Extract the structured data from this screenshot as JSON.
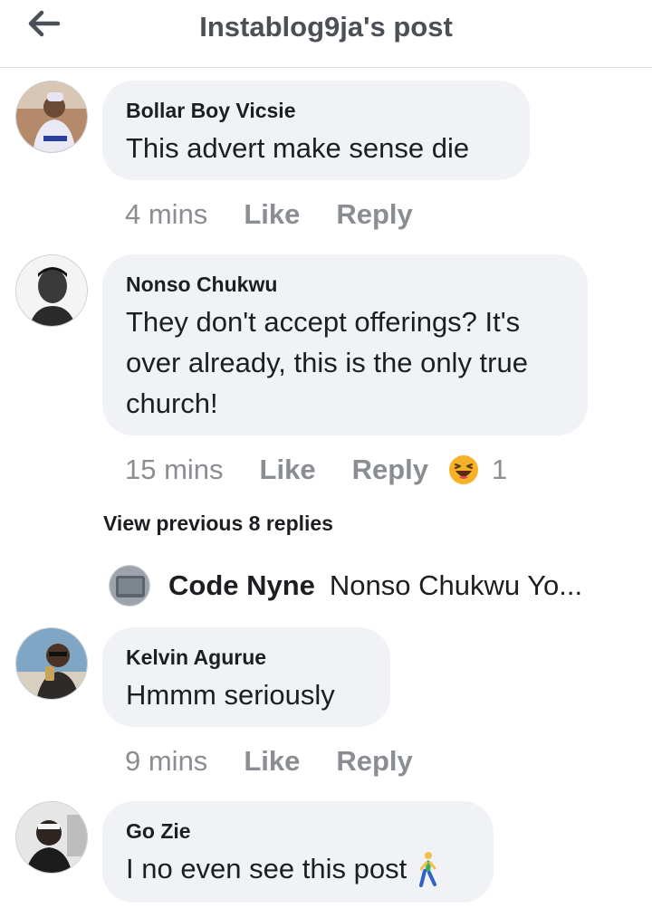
{
  "header": {
    "title": "Instablog9ja's post",
    "back_icon": "arrow-left-icon"
  },
  "comments": [
    {
      "author": "Bollar Boy Vicsie",
      "text": "This advert make sense die",
      "time": "4 mins",
      "like_label": "Like",
      "reply_label": "Reply"
    },
    {
      "author": "Nonso Chukwu",
      "text_lines": [
        "They don't accept offerings? It's",
        "over already, this is the only true",
        "church!"
      ],
      "time": "15 mins",
      "like_label": "Like",
      "reply_label": "Reply",
      "reaction_icon": "laughing-emoji-icon",
      "reaction_count": "1"
    },
    {
      "author": "Kelvin Agurue",
      "text": "Hmmm seriously",
      "time": "9 mins",
      "like_label": "Like",
      "reply_label": "Reply"
    },
    {
      "author": "Go Zie",
      "text": "I no even see this post",
      "emoji_icon": "person-walking-emoji-icon"
    }
  ],
  "replies": {
    "view_previous_label": "View previous 8 replies",
    "latest": {
      "author": "Code Nyne",
      "text": "Nonso Chukwu  Yo..."
    }
  },
  "colors": {
    "bubble": "#f0f2f5",
    "meta": "#8a8d91",
    "text": "#1c1e21"
  }
}
